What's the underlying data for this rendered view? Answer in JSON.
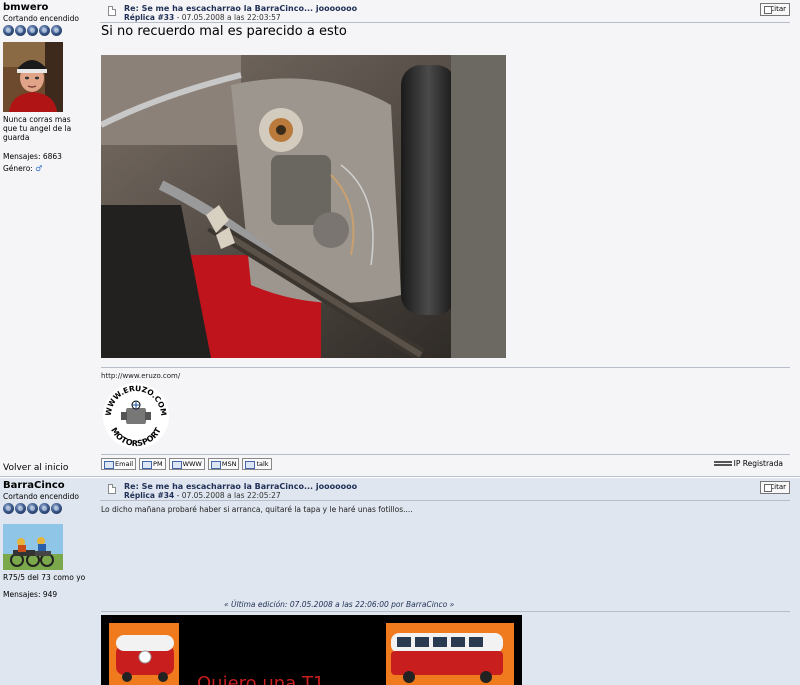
{
  "post1": {
    "author_name": "bmwero",
    "author_rank": "Cortando encendido",
    "author_text": "Nunca corras mas que tu angel de la guarda",
    "messages": "Mensajes: 6863",
    "gender_label": "Género:",
    "subject": "Re: Se me ha escacharrao la BarraCinco... jooooooo",
    "reply_label": "Réplica #33",
    "date": " - 07.05.2008 a las 22:03:57",
    "quote_label": "Citar",
    "body": "Si no recuerdo mal es parecido a esto",
    "signature_url": "http://www.eruzo.com/",
    "logo_top_text": "WWW.ERUZO.COM",
    "logo_bottom_text": "MOTORSPORT",
    "buttons": {
      "email": "Email",
      "pm": "PM",
      "www": "WWW",
      "msn": "MSN",
      "talk": "talk"
    },
    "ip_label": "IP Registrada",
    "back_link": "Volver al inicio"
  },
  "post2": {
    "author_name": "BarraCinco",
    "author_rank": "Cortando encendido",
    "author_text": "R75/5 del 73 como yo",
    "messages": "Mensajes: 949",
    "subject": "Re: Se me ha escacharrao la BarraCinco... jooooooo",
    "reply_label": "Réplica #34",
    "date": " - 07.05.2008 a las 22:05:27",
    "quote_label": "Citar",
    "body": "Lo dicho mañana probaré haber si arranca, quitaré la tapa y le haré unas fotillos....",
    "edit_note": "« Última edición: 07.05.2008 a las 22:06:00 por BarraCinco »",
    "banner_text": "Quiero una T1"
  },
  "colors": {
    "link": "#1f2f55",
    "post1_bg": "#f5f5f7",
    "post2_bg": "#dfe6ef",
    "banner_red": "#c81e1e",
    "banner_orange": "#f07a1e"
  }
}
